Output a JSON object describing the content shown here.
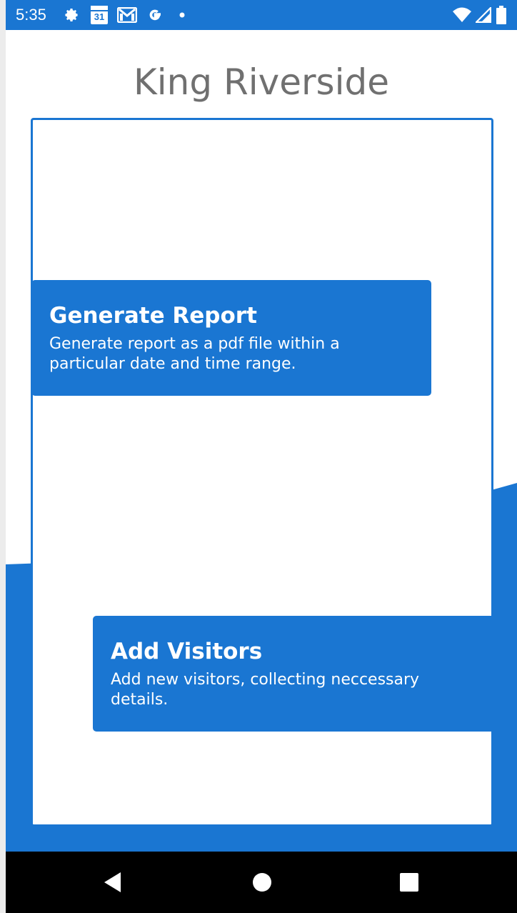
{
  "status_bar": {
    "time": "5:35",
    "calendar_day": "31",
    "icons": [
      "gear-icon",
      "calendar-icon",
      "gmail-icon",
      "google-g-icon",
      "notification-dot-icon",
      "wifi-icon",
      "cell-signal-icon",
      "battery-icon"
    ]
  },
  "app": {
    "title": "King Riverside",
    "accent_color": "#1a76d2"
  },
  "actions": [
    {
      "title": "Generate Report",
      "description": "Generate report as a pdf file within a particular date and time range."
    },
    {
      "title": "Add Visitors",
      "description": "Add new visitors, collecting neccessary details."
    }
  ],
  "nav_bar": {
    "icons": [
      "back-icon",
      "home-icon",
      "recents-icon"
    ]
  }
}
